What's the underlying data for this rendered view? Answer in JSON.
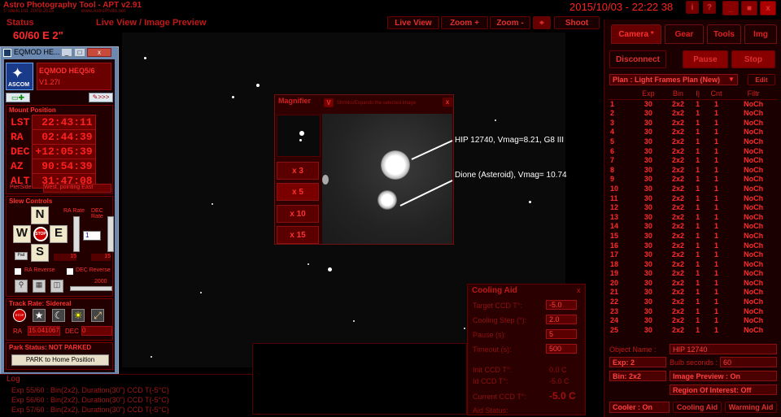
{
  "app": {
    "title": "Astro Photography Tool - APT v2.91",
    "copyright": "© Ideiki Ltd. 2009-2015",
    "site": "www.AstroPhoto.net",
    "datetime": "2015/10/03 - 22:22 38"
  },
  "window_buttons": {
    "info": "i",
    "help": "?",
    "minimize": "_",
    "maximize": "■",
    "close": "x"
  },
  "status": {
    "label": "Status",
    "value": "60/60 E  2\""
  },
  "liveview": {
    "title": "Live View / Image Preview",
    "live_view_btn": "Live View",
    "zoom_in_btn": "Zoom +",
    "zoom_out_btn": "Zoom -",
    "target_btn": "⌖",
    "shoot_btn": "Shoot"
  },
  "eqmod": {
    "window_title": "EQMOD HE...",
    "ascom": "ASCOM",
    "mount": "EQMOD HEQ5/6",
    "version": "V1.27l",
    "mount_position_title": "Mount Position",
    "rows": [
      {
        "k": "LST",
        "v": "22:43:11"
      },
      {
        "k": "RA",
        "v": "02:44:39"
      },
      {
        "k": "DEC",
        "v": "+12:05:39"
      },
      {
        "k": "AZ",
        "v": "90:54:39"
      },
      {
        "k": "ALT",
        "v": "31:47:08"
      }
    ],
    "pierside_label": "PierSide",
    "pierside_value": "West, pointing East",
    "slew_title": "Slew Controls",
    "ra_rate": "RA Rate",
    "dec_rate": "DEC Rate",
    "n": "N",
    "s": "S",
    "e": "E",
    "w": "W",
    "stop": "STOP",
    "pad": "Pad",
    "rate_value": "1",
    "ra_rate_val": "15",
    "dec_rate_val": "15",
    "ra_reverse": "RA Reverse",
    "dec_reverse": "DEC Reverse",
    "slider_val": "2000",
    "track_title": "Track Rate: Sidereal",
    "ra_label": "RA",
    "ra_track": "15.041067",
    "dec_label": "DEC",
    "dec_track": "0",
    "park_status": "Park Status: NOT PARKED",
    "park_btn": "PARK to Home Position"
  },
  "magnifier": {
    "title": "Magnifier",
    "hint": "Shrinks/Expands the selected image",
    "buttons": [
      "x 3",
      "x 5",
      "x 10",
      "x 15"
    ],
    "close": "x",
    "toggle": "V"
  },
  "annotations": [
    "HIP 12740, Vmag=8.21, G8 III",
    "Dione (Asteroid), Vmag= 10.74"
  ],
  "cooling": {
    "title": "Cooling Aid",
    "close": "x",
    "rows": [
      {
        "k": "Target CCD T°:",
        "v": "-5.0"
      },
      {
        "k": "Cooling Step (°):",
        "v": "2.0"
      },
      {
        "k": "Pause (s):",
        "v": "5"
      },
      {
        "k": "Timeout (s):",
        "v": "500"
      }
    ],
    "info": [
      {
        "k": "Init CCD T°:",
        "v": "0.0 C"
      },
      {
        "k": "Id CCD T°:",
        "v": "-5.0 C"
      },
      {
        "k": "Current CCD T°:",
        "v": "-5.0 C"
      },
      {
        "k": "Aid Status:",
        "v": ""
      }
    ]
  },
  "log": {
    "title": "Log",
    "lines": [
      "Exp 55/60 : Bin(2x2), Duration(30\") CCD T(-5°C)",
      "Exp 56/60 : Bin(2x2), Duration(30\") CCD T(-5°C)",
      "Exp 57/60 : Bin(2x2), Duration(30\") CCD T(-5°C)"
    ]
  },
  "right_panel": {
    "tabs": [
      "Camera *",
      "Gear",
      "Tools",
      "Img"
    ],
    "disconnect": "Disconnect",
    "pause": "Pause",
    "stop": "Stop",
    "plan": "Plan : Light Frames Plan (New)",
    "edit": "Edit",
    "headers": [
      "",
      "Exp",
      "Bin",
      "I|",
      "Cnt",
      "Filtr"
    ],
    "rows": [
      [
        "1",
        "30",
        "2x2",
        "1",
        "1",
        "NoCh"
      ],
      [
        "2",
        "30",
        "2x2",
        "1",
        "1",
        "NoCh"
      ],
      [
        "3",
        "30",
        "2x2",
        "1",
        "1",
        "NoCh"
      ],
      [
        "4",
        "30",
        "2x2",
        "1",
        "1",
        "NoCh"
      ],
      [
        "5",
        "30",
        "2x2",
        "1",
        "1",
        "NoCh"
      ],
      [
        "6",
        "30",
        "2x2",
        "1",
        "1",
        "NoCh"
      ],
      [
        "7",
        "30",
        "2x2",
        "1",
        "1",
        "NoCh"
      ],
      [
        "8",
        "30",
        "2x2",
        "1",
        "1",
        "NoCh"
      ],
      [
        "9",
        "30",
        "2x2",
        "1",
        "1",
        "NoCh"
      ],
      [
        "10",
        "30",
        "2x2",
        "1",
        "1",
        "NoCh"
      ],
      [
        "11",
        "30",
        "2x2",
        "1",
        "1",
        "NoCh"
      ],
      [
        "12",
        "30",
        "2x2",
        "1",
        "1",
        "NoCh"
      ],
      [
        "13",
        "30",
        "2x2",
        "1",
        "1",
        "NoCh"
      ],
      [
        "14",
        "30",
        "2x2",
        "1",
        "1",
        "NoCh"
      ],
      [
        "15",
        "30",
        "2x2",
        "1",
        "1",
        "NoCh"
      ],
      [
        "16",
        "30",
        "2x2",
        "1",
        "1",
        "NoCh"
      ],
      [
        "17",
        "30",
        "2x2",
        "1",
        "1",
        "NoCh"
      ],
      [
        "18",
        "30",
        "2x2",
        "1",
        "1",
        "NoCh"
      ],
      [
        "19",
        "30",
        "2x2",
        "1",
        "1",
        "NoCh"
      ],
      [
        "20",
        "30",
        "2x2",
        "1",
        "1",
        "NoCh"
      ],
      [
        "21",
        "30",
        "2x2",
        "1",
        "1",
        "NoCh"
      ],
      [
        "22",
        "30",
        "2x2",
        "1",
        "1",
        "NoCh"
      ],
      [
        "23",
        "30",
        "2x2",
        "1",
        "1",
        "NoCh"
      ],
      [
        "24",
        "30",
        "2x2",
        "1",
        "1",
        "NoCh"
      ],
      [
        "25",
        "30",
        "2x2",
        "1",
        "1",
        "NoCh"
      ]
    ],
    "object_label": "Object Name :",
    "object_value": "HIP 12740",
    "exp": "Exp: 2",
    "bulb_label": "Bulb seconds :",
    "bulb_value": "60",
    "bin": "Bin: 2x2",
    "image_preview": "Image Preview : On",
    "roi": "Region Of Interest: Off",
    "cooler": "Cooler : On",
    "cooling_aid": "Cooling Aid",
    "warming_aid": "Warming Aid"
  }
}
